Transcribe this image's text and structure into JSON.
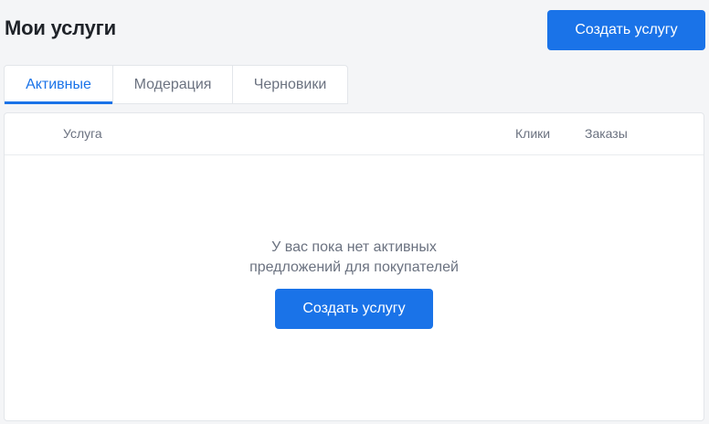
{
  "header": {
    "title": "Мои услуги",
    "create_button": "Создать услугу"
  },
  "tabs": [
    {
      "label": "Активные",
      "active": true
    },
    {
      "label": "Модерация",
      "active": false
    },
    {
      "label": "Черновики",
      "active": false
    }
  ],
  "table": {
    "columns": [
      "Услуга",
      "Клики",
      "Заказы"
    ]
  },
  "empty_state": {
    "line1": "У вас пока нет активных",
    "line2": "предложений для покупателей",
    "button": "Создать услугу"
  },
  "colors": {
    "accent": "#1a73e8",
    "background": "#f4f5f7"
  }
}
